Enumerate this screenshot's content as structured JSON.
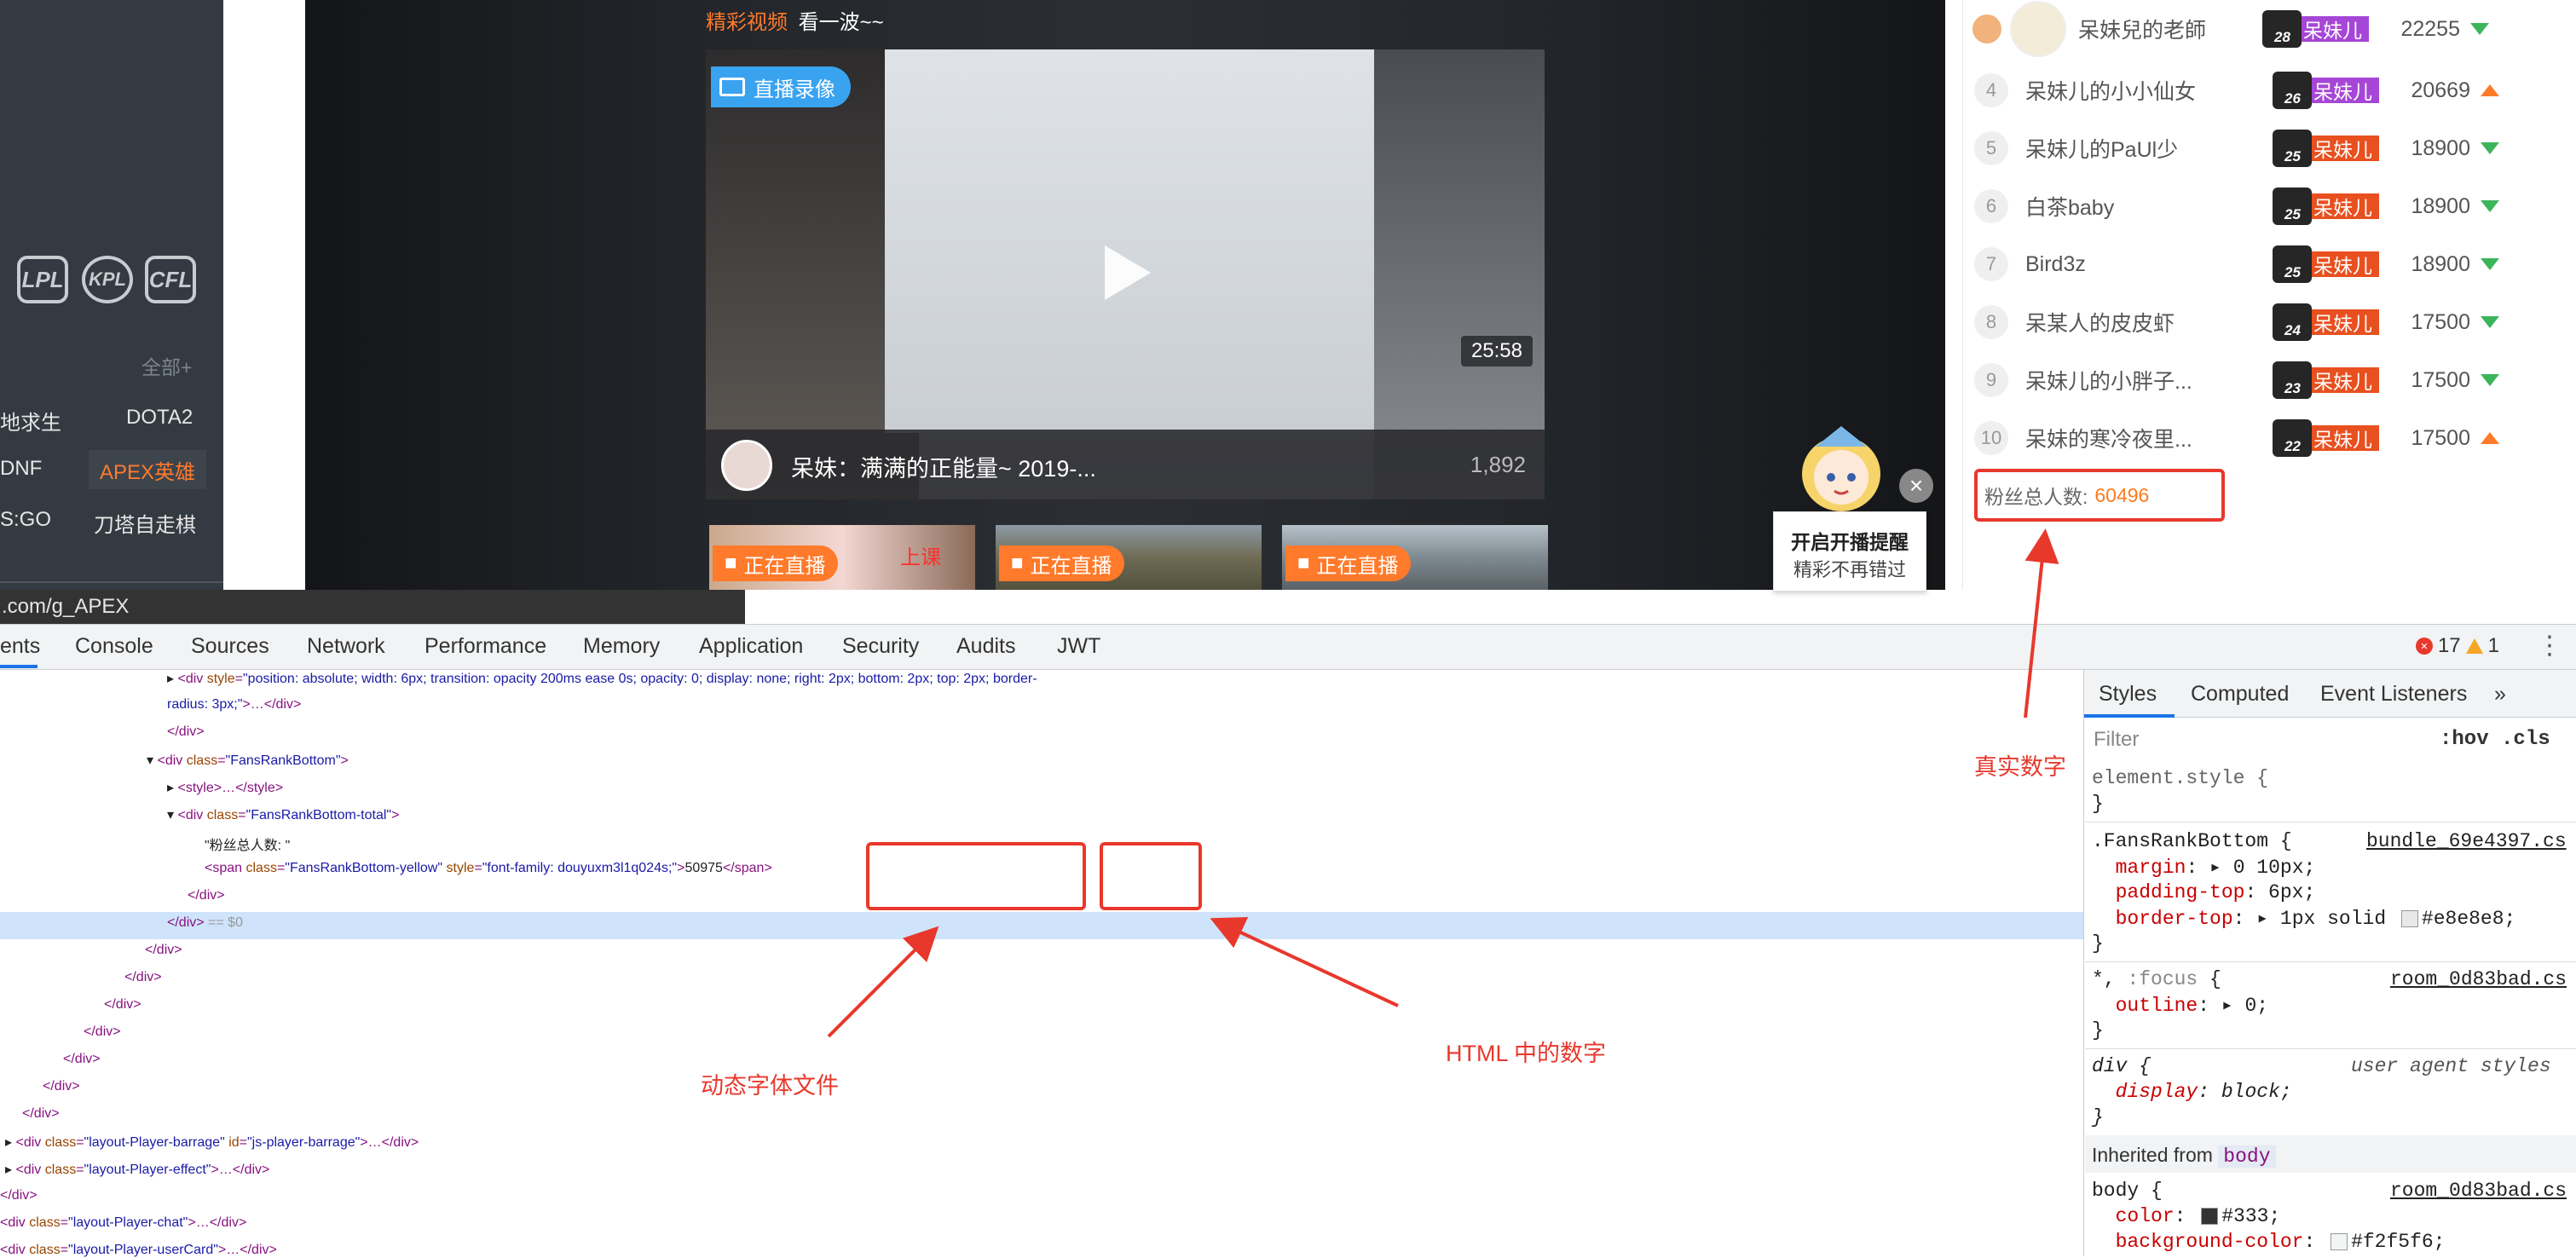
{
  "left_nav": {
    "logos": [
      "LPL",
      "KPL",
      "CFL"
    ],
    "all_label": "全部+",
    "rows": [
      {
        "a": "地求生",
        "b": "DOTA2"
      },
      {
        "a": "DNF",
        "b": "APEX英雄"
      },
      {
        "a": "S:GO",
        "b": "刀塔自走棋"
      }
    ],
    "collapse": "‹"
  },
  "video": {
    "topline_orange": "精彩视频",
    "topline_white": "看一波~~",
    "replay_badge": "直播录像",
    "duration": "25:58",
    "title": "呆妹：满满的正能量~ 2019-...",
    "views": "1,892",
    "thumbs": [
      {
        "live": "正在直播",
        "extra": "上课"
      },
      {
        "live": "正在直播"
      },
      {
        "live": "正在直播"
      }
    ]
  },
  "popup": {
    "line1": "开启开播提醒",
    "line2": "精彩不再错过",
    "close": "×"
  },
  "rank": {
    "top3": {
      "name": "呆妹兒的老師",
      "level": "28",
      "badge": "呆妹儿",
      "score": "22255",
      "trend": "down"
    },
    "rows": [
      {
        "n": "4",
        "name": "呆妹儿的小小仙女",
        "level": "26",
        "badge": "呆妹儿",
        "score": "20669",
        "trend": "up"
      },
      {
        "n": "5",
        "name": "呆妹儿的PaUl少",
        "level": "25",
        "badge": "呆妹儿",
        "score": "18900",
        "trend": "down"
      },
      {
        "n": "6",
        "name": "白茶baby",
        "level": "25",
        "badge": "呆妹儿",
        "score": "18900",
        "trend": "down"
      },
      {
        "n": "7",
        "name": "Bird3z",
        "level": "25",
        "badge": "呆妹儿",
        "score": "18900",
        "trend": "down"
      },
      {
        "n": "8",
        "name": "呆某人的皮皮虾",
        "level": "24",
        "badge": "呆妹儿",
        "score": "17500",
        "trend": "down"
      },
      {
        "n": "9",
        "name": "呆妹儿的小胖子...",
        "level": "23",
        "badge": "呆妹儿",
        "score": "17500",
        "trend": "down"
      },
      {
        "n": "10",
        "name": "呆妹的寒冷夜里...",
        "level": "22",
        "badge": "呆妹儿",
        "score": "17500",
        "trend": "up"
      }
    ],
    "fans_label": "粉丝总人数:",
    "fans_value": "60496"
  },
  "url": ".com/g_APEX",
  "devtools": {
    "tabs": [
      "ents",
      "Console",
      "Sources",
      "Network",
      "Performance",
      "Memory",
      "Application",
      "Security",
      "Audits",
      "JWT"
    ],
    "errors": "17",
    "warnings": "1",
    "kebab": "⋮",
    "sidebar_tabs": [
      "Styles",
      "Computed",
      "Event Listeners",
      "»"
    ],
    "filter_placeholder": "Filter",
    "hov_cls": ":hov  .cls"
  },
  "annotations": {
    "real_number": "真实数字",
    "dynamic_font": "动态字体文件",
    "html_number": "HTML 中的数字"
  },
  "colors": {
    "accent": "#ff7a2a",
    "red": "#e8382c",
    "blue": "#1a73e8",
    "selected": "#cfe4fb"
  }
}
